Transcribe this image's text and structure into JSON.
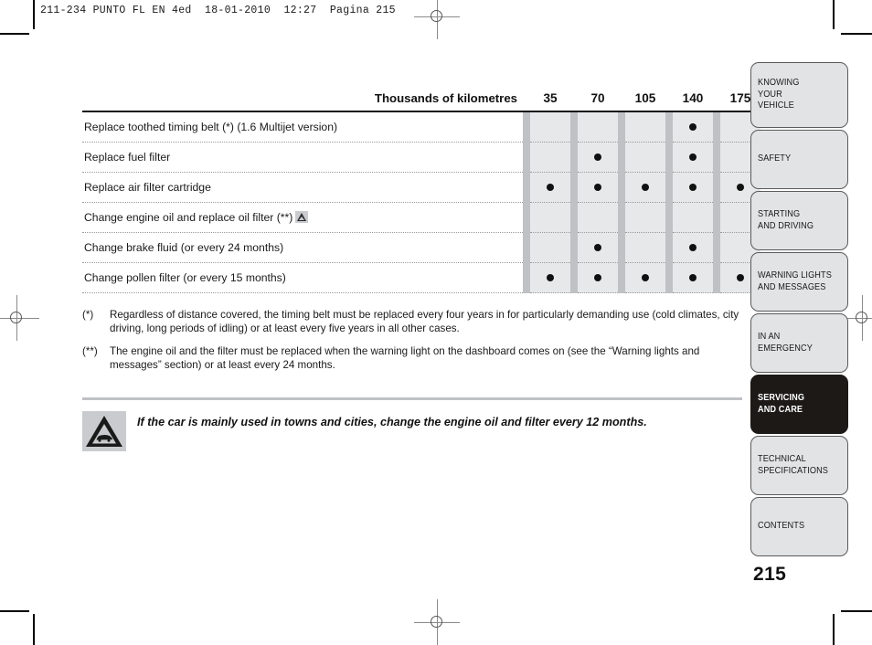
{
  "running_head": "211-234 PUNTO FL EN 4ed  18-01-2010  12:27  Pagina 215",
  "table": {
    "header_label": "Thousands of kilometres",
    "columns": [
      "35",
      "70",
      "105",
      "140",
      "175"
    ],
    "rows": [
      {
        "label": "Replace toothed timing belt (*) (1.6 Multijet version)",
        "has_icon": false,
        "dots": [
          false,
          false,
          false,
          true,
          false
        ]
      },
      {
        "label": "Replace fuel filter",
        "has_icon": false,
        "dots": [
          false,
          true,
          false,
          true,
          false
        ]
      },
      {
        "label": "Replace air filter cartridge",
        "has_icon": false,
        "dots": [
          true,
          true,
          true,
          true,
          true
        ]
      },
      {
        "label": "Change engine oil and replace oil filter (**)",
        "has_icon": true,
        "icon": "warning-triangle-icon",
        "dots": [
          false,
          false,
          false,
          false,
          false
        ]
      },
      {
        "label": "Change brake fluid (or every 24 months)",
        "has_icon": false,
        "dots": [
          false,
          true,
          false,
          true,
          false
        ]
      },
      {
        "label": "Change pollen filter (or every 15 months)",
        "has_icon": false,
        "dots": [
          true,
          true,
          true,
          true,
          true
        ]
      }
    ]
  },
  "footnotes": [
    {
      "marker": "(*)",
      "text": "Regardless of distance covered, the timing belt must be replaced every four years in for particularly demanding use (cold climates, city driving, long periods of idling) or at least every five years in all other cases."
    },
    {
      "marker": "(**)",
      "text": "The engine oil and the filter must be replaced when the warning light on the dashboard comes on (see the “Warning lights and messages” section) or at least every 24 months."
    }
  ],
  "warning": {
    "icon": "car-warning-triangle-icon",
    "text": "If the car is mainly used in towns and cities, change the engine oil and filter every 12 months."
  },
  "side_tabs": [
    {
      "label": "KNOWING YOUR VEHICLE",
      "lines": [
        "KNOWING",
        "YOUR",
        "VEHICLE"
      ],
      "active": false
    },
    {
      "label": "SAFETY",
      "lines": [
        "SAFETY"
      ],
      "active": false
    },
    {
      "label": "STARTING AND DRIVING",
      "lines": [
        "STARTING",
        "AND DRIVING"
      ],
      "active": false
    },
    {
      "label": "WARNING LIGHTS AND MESSAGES",
      "lines": [
        "WARNING LIGHTS",
        "AND MESSAGES"
      ],
      "active": false
    },
    {
      "label": "IN AN EMERGENCY",
      "lines": [
        "IN AN",
        "EMERGENCY"
      ],
      "active": false
    },
    {
      "label": "SERVICING AND CARE",
      "lines": [
        "SERVICING",
        "AND CARE"
      ],
      "active": true
    },
    {
      "label": "TECHNICAL SPECIFICATIONS",
      "lines": [
        "TECHNICAL",
        "SPECIFICATIONS"
      ],
      "active": false
    },
    {
      "label": "CONTENTS",
      "lines": [
        "CONTENTS"
      ],
      "active": false
    }
  ],
  "page_number": "215",
  "colors": {
    "data_cell_bg": "#e7e8ea",
    "separator_bar": "#bfc1c4",
    "tab_bg": "#e2e3e5",
    "tab_active_bg": "#1c1917",
    "dot": "#111111"
  }
}
